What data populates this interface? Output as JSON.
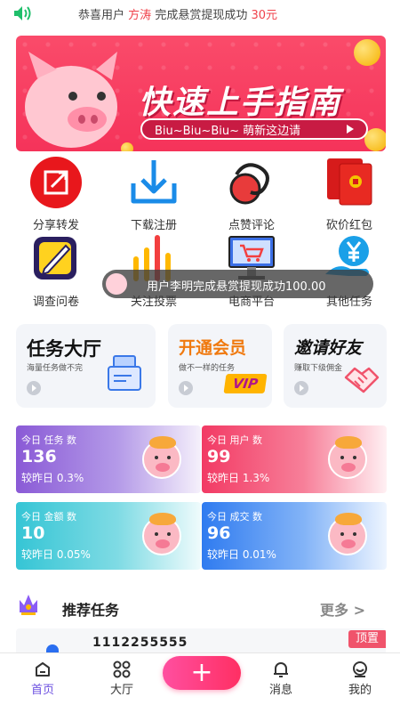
{
  "marquee": {
    "prefix": "恭喜用户",
    "user": "方涛",
    "action": "完成悬赏提现成功",
    "amount": "30元"
  },
  "banner": {
    "title": "快速上手指南",
    "pill_text": "Biu~Biu~Biu~ 萌新这边请"
  },
  "grid": {
    "share": "分享转发",
    "download": "下载注册",
    "like": "点赞评论",
    "redpacket": "砍价红包",
    "survey": "调查问卷",
    "vote": "关注投票",
    "ecommerce": "电商平台",
    "other": "其他任务"
  },
  "toast": {
    "text": "用户李明完成悬赏提现成功100.00"
  },
  "promos": {
    "hall": {
      "title": "任务大厅",
      "sub": "海量任务做不完"
    },
    "vip": {
      "title": "开通会员",
      "sub": "做不一样的任务",
      "badge": "VIP"
    },
    "invite": {
      "title": "邀请好友",
      "sub": "赚取下级佣金"
    }
  },
  "stats": {
    "tasks": {
      "label": "今日 任务 数",
      "value": "136",
      "compare": "较昨日 0.3%"
    },
    "users": {
      "label": "今日 用户 数",
      "value": "99",
      "compare": "较昨日 1.3%"
    },
    "amount": {
      "label": "今日 金额 数",
      "value": "10",
      "compare": "较昨日 0.05%"
    },
    "deals": {
      "label": "今日 成交 数",
      "value": "96",
      "compare": "较昨日 0.01%"
    }
  },
  "recommend": {
    "title": "推荐任务",
    "more": "更多 >"
  },
  "task": {
    "number": "1112255555",
    "pin": "顶置"
  },
  "nav": {
    "home": "首页",
    "hall": "大厅",
    "plus": "+",
    "messages": "消息",
    "mine": "我的"
  },
  "colors": {
    "accent": "#6b4fe0",
    "brand_red": "#f5335a"
  }
}
